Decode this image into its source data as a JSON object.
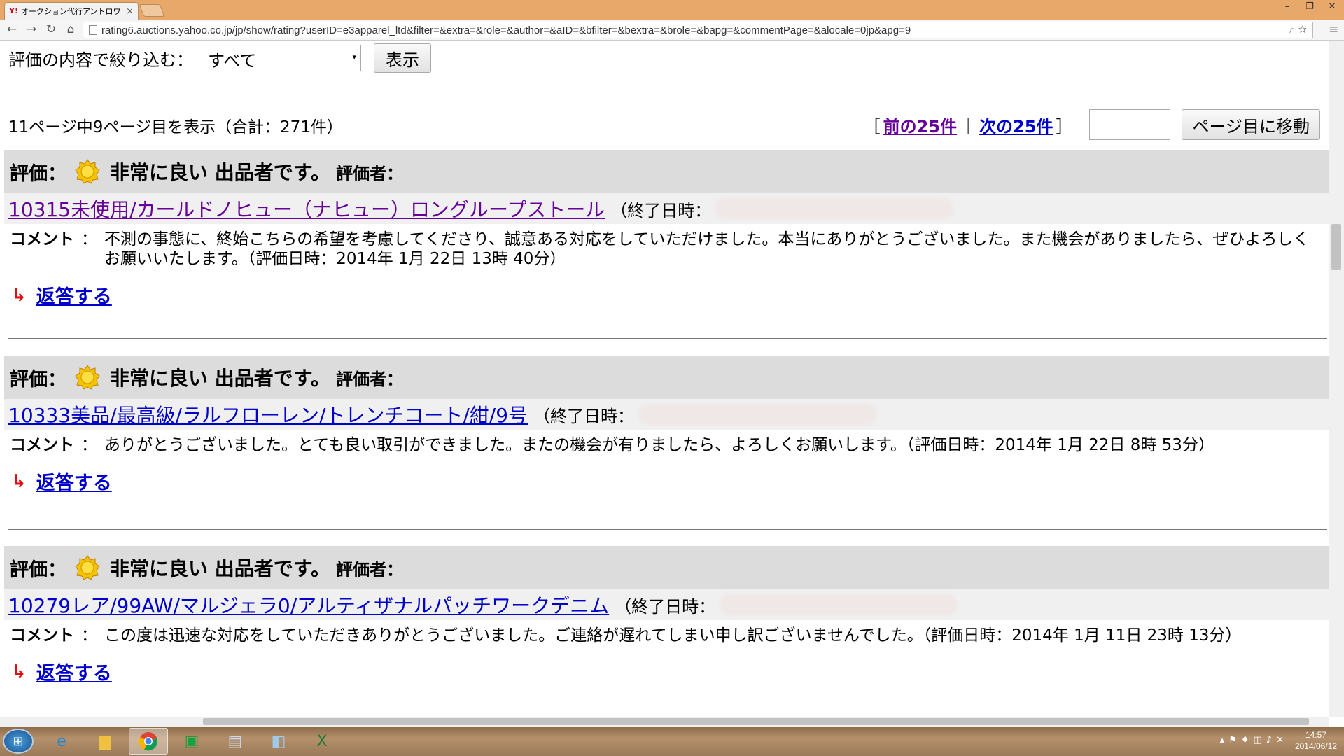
{
  "browser": {
    "tab_title": "オークション代行アントロワ（オ",
    "tab_favicon": "Y!",
    "url": "rating6.auctions.yahoo.co.jp/jp/show/rating?userID=e3apparel_ltd&filter=&extra=&role=&author=&aID=&bfilter=&bextra=&brole=&bapg=&commentPage=&alocale=0jp&apg=9"
  },
  "filter": {
    "label": "評価の内容で絞り込む：",
    "selected": "すべて",
    "button": "表示"
  },
  "pagination": {
    "info": "11ページ中9ページ目を表示（合計：271件）",
    "open_bracket": "［",
    "prev": "前の25件",
    "separator": "｜",
    "next": "次の25件",
    "close_bracket": "］",
    "goto_button": "ページ目に移動"
  },
  "reviews": [
    {
      "label": "評価：",
      "rating": "非常に良い 出品者です。",
      "rater": "評価者：",
      "item": "10315未使用/カールドノヒュー（ナヒュー）ロングループストール",
      "end": "（終了日時：",
      "comment_label": "コメント",
      "comment": "不測の事態に、終始こちらの希望を考慮してくださり、誠意ある対応をしていただけました。本当にありがとうございました。また機会がありましたら、ぜひよろしくお願いいたします。（評価日時：2014年 1月 22日 13時 40分）",
      "reply": "返答する"
    },
    {
      "label": "評価：",
      "rating": "非常に良い 出品者です。",
      "rater": "評価者：",
      "item": "10333美品/最高級/ラルフローレン/トレンチコート/紺/9号",
      "end": "（終了日時：",
      "comment_label": "コメント",
      "comment": "ありがとうございました。とても良い取引ができました。またの機会が有りましたら、よろしくお願いします。（評価日時：2014年 1月 22日 8時 53分）",
      "reply": "返答する"
    },
    {
      "label": "評価：",
      "rating": "非常に良い 出品者です。",
      "rater": "評価者：",
      "item": "10279レア/99AW/マルジェラ0/アルティザナルパッチワークデニム",
      "end": "（終了日時：",
      "comment_label": "コメント",
      "comment": "この度は迅速な対応をしていただきありがとうございました。ご連絡が遅れてしまい申し訳ございませんでした。（評価日時：2014年 1月 11日 23時 13分）",
      "reply": "返答する"
    }
  ],
  "taskbar": {
    "time": "14:57",
    "date": "2014/06/12"
  },
  "colors": {
    "visited_link": "#660099",
    "link": "#0000cc",
    "review_header_bg": "#dcdcdc",
    "reply_arrow": "#e01010"
  }
}
